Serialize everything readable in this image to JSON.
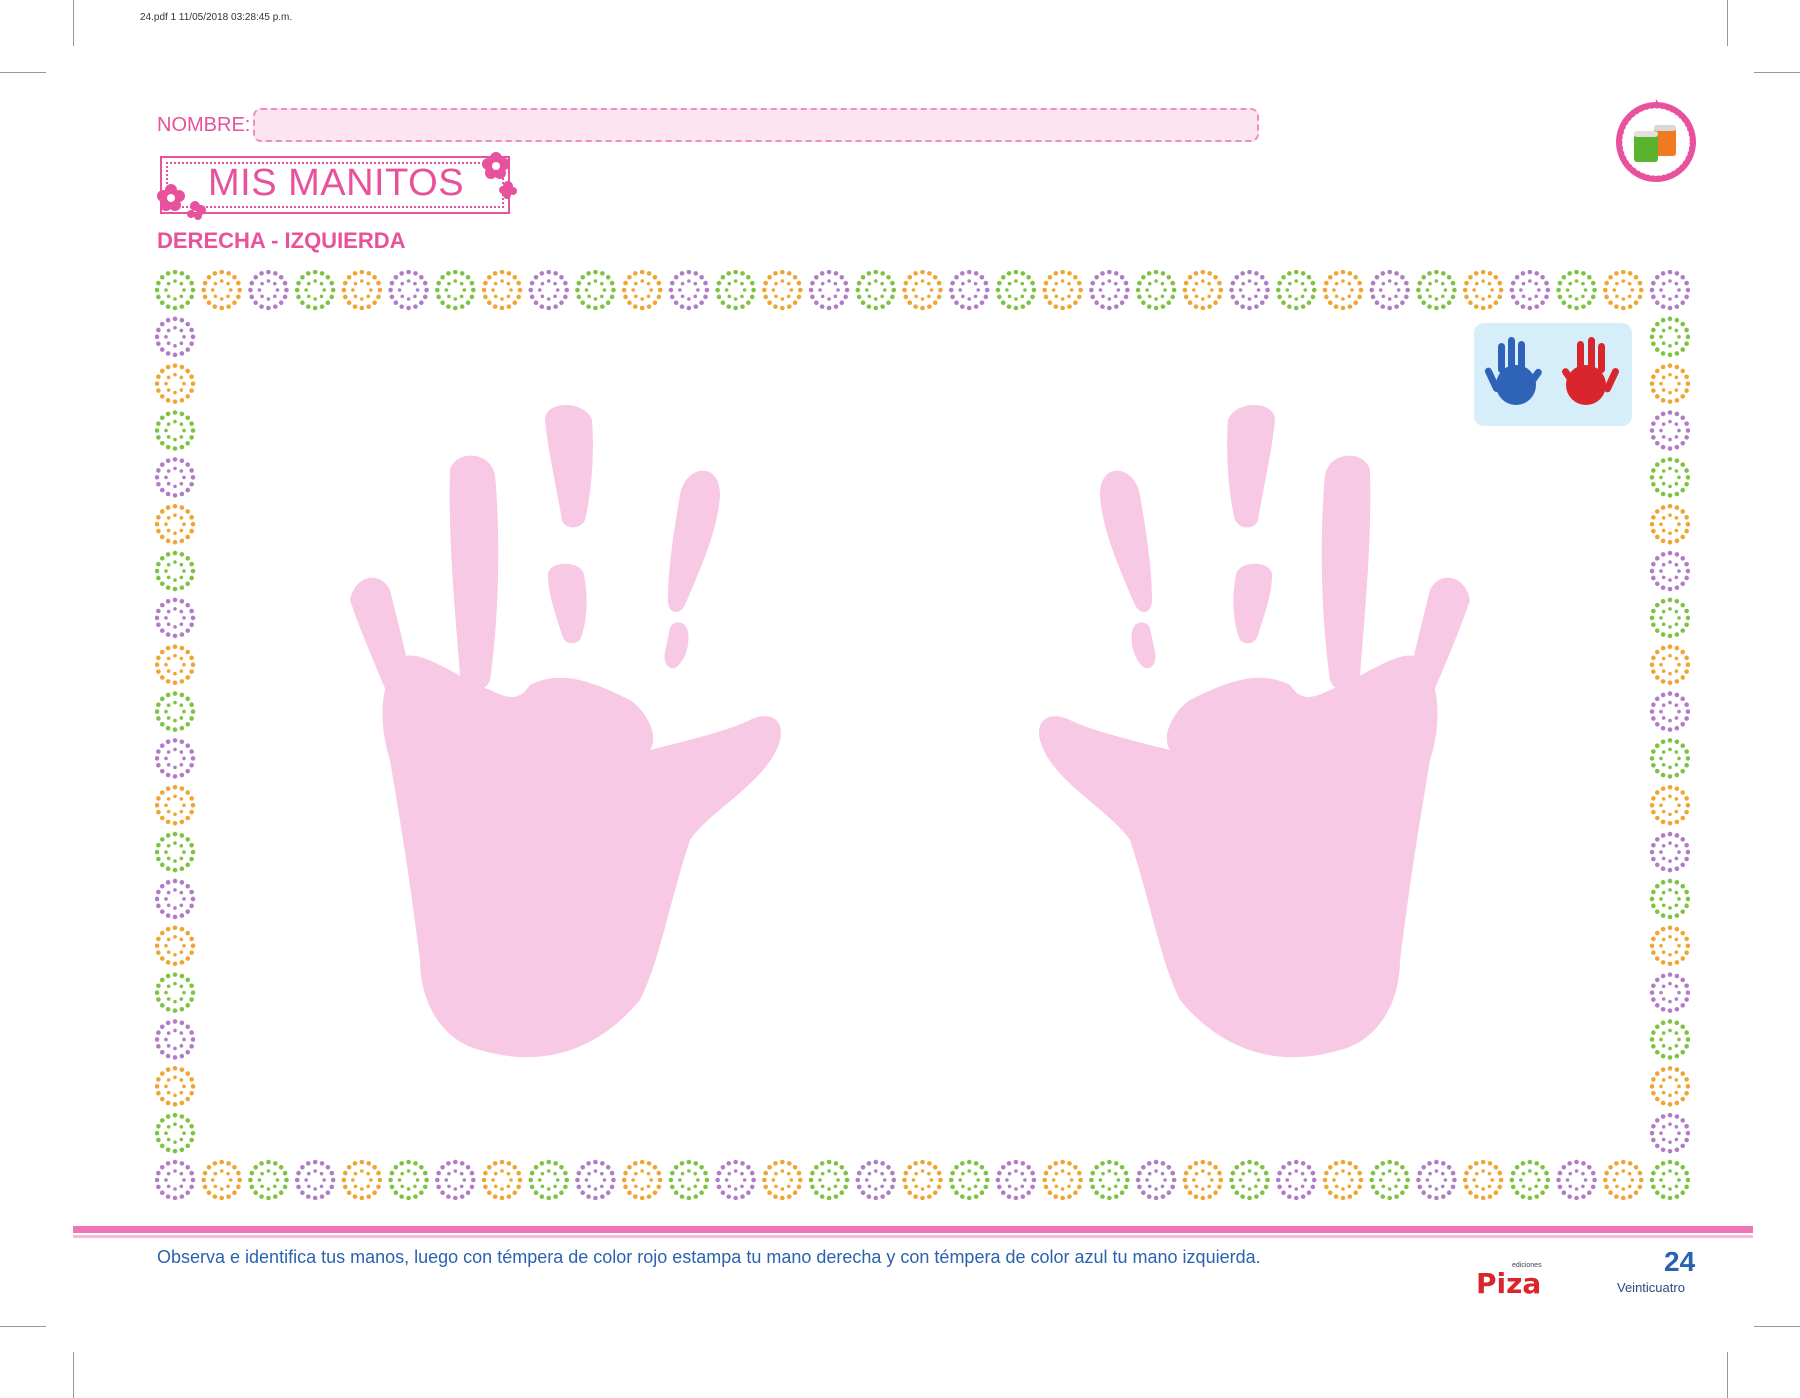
{
  "pdf_meta": "24.pdf   1   11/05/2018   03:28:45 p.m.",
  "header": {
    "nombre_label": "NOMBRE:",
    "title": "MIS MANITOS",
    "subtitle": "DERECHA - IZQUIERDA"
  },
  "colors": {
    "pink": "#e8519b",
    "hand_pink": "#f8c9e4",
    "ring_green": "#7ec242",
    "ring_orange": "#f0a431",
    "ring_purple": "#b07cc6",
    "model_blue_hand": "#2e63b8",
    "model_red_hand": "#d9262c"
  },
  "footer": {
    "instruction": "Observa e identifica tus manos, luego con témpera de color rojo estampa tu mano derecha y con témpera de color azul tu mano izquierda.",
    "brand_small": "ediciones",
    "brand": "Piza",
    "page_number": "24",
    "page_word": "Veinticuatro"
  },
  "icons": [
    "paint-jars-icon",
    "flower-icon",
    "handprint-icon"
  ]
}
